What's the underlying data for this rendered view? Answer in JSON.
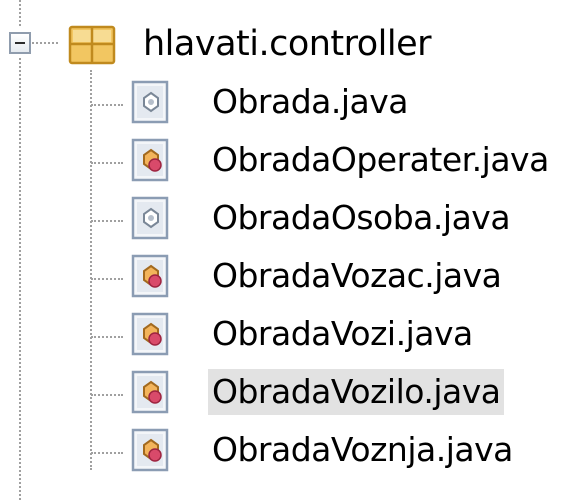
{
  "tree": {
    "package": {
      "name": "hlavati.controller",
      "icon": "package-icon",
      "expanded": true
    },
    "files": [
      {
        "label": "Obrada.java",
        "icon": "abstract-class-file-icon",
        "selected": false
      },
      {
        "label": "ObradaOperater.java",
        "icon": "class-file-icon",
        "selected": false
      },
      {
        "label": "ObradaOsoba.java",
        "icon": "abstract-class-file-icon",
        "selected": false
      },
      {
        "label": "ObradaVozac.java",
        "icon": "class-file-icon",
        "selected": false
      },
      {
        "label": "ObradaVozi.java",
        "icon": "class-file-icon",
        "selected": false
      },
      {
        "label": "ObradaVozilo.java",
        "icon": "class-file-icon",
        "selected": true
      },
      {
        "label": "ObradaVoznja.java",
        "icon": "class-file-icon",
        "selected": false
      }
    ]
  },
  "colors": {
    "selection": "#e2e2e2",
    "guide_line": "#a0a0a0",
    "package_icon": "#e8b84a"
  }
}
